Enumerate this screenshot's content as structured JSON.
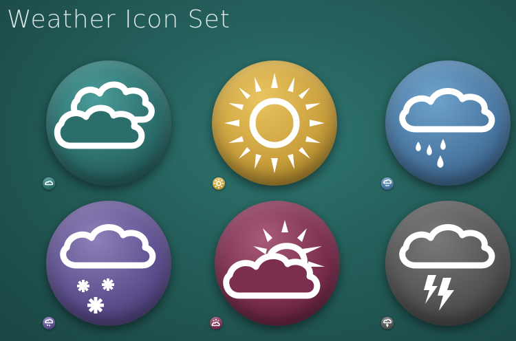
{
  "title": "Weather Icon Set",
  "icons": [
    {
      "name": "cloudy",
      "color": "#2c6e6c"
    },
    {
      "name": "sunny",
      "color": "#caa03c"
    },
    {
      "name": "rain",
      "color": "#4a78a2"
    },
    {
      "name": "snow",
      "color": "#5f5190"
    },
    {
      "name": "partly-cloudy",
      "color": "#7b2e4e"
    },
    {
      "name": "thunderstorm",
      "color": "#555555"
    }
  ]
}
